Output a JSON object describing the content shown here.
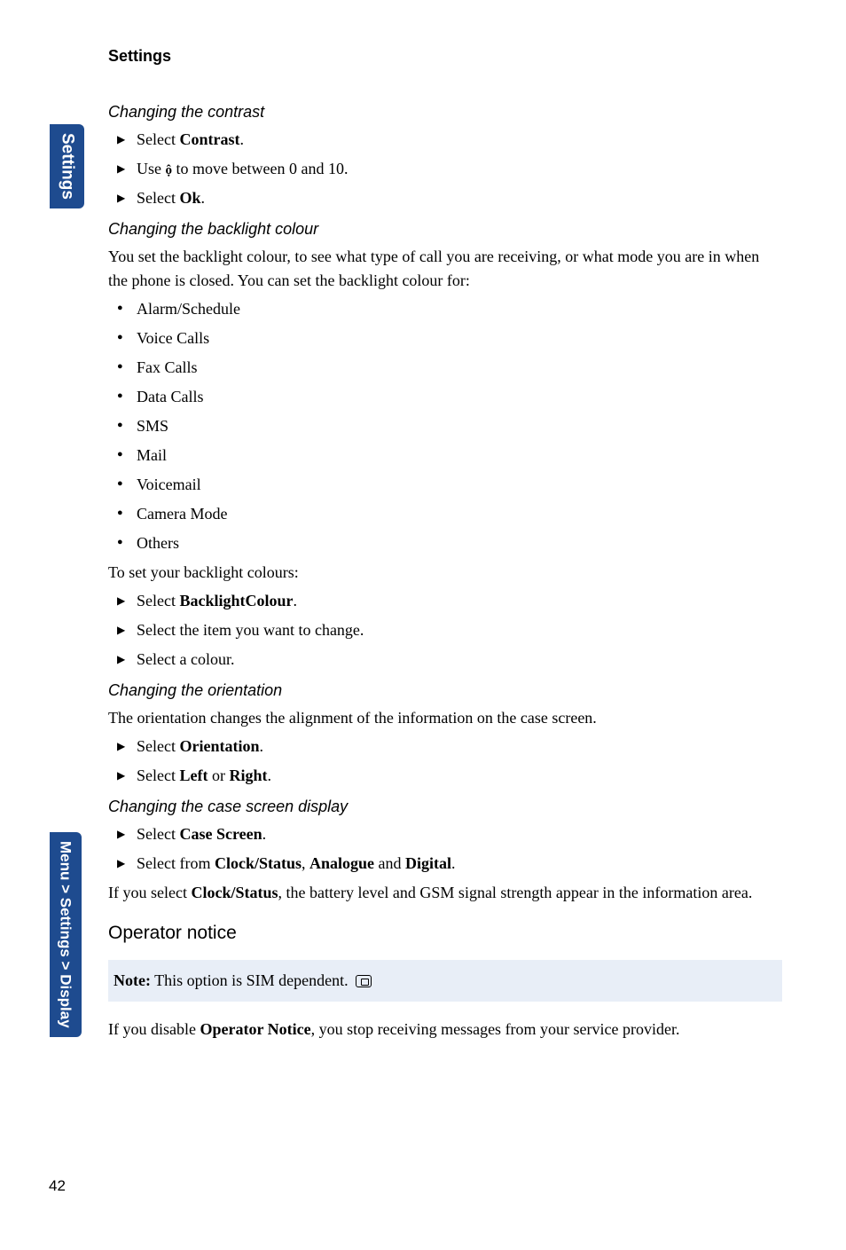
{
  "sidebar": {
    "tab_top": "Settings",
    "tab_bottom": "Menu > Settings > Display"
  },
  "page": {
    "title": "Settings",
    "number": "42"
  },
  "sections": {
    "contrast": {
      "heading": "Changing the contrast",
      "step1_a": "Select ",
      "step1_b": "Contrast",
      "step1_c": ".",
      "step2_a": "Use ",
      "step2_b": " to move between 0 and 10.",
      "step3_a": "Select ",
      "step3_b": "Ok",
      "step3_c": "."
    },
    "backlight": {
      "heading": "Changing the backlight colour",
      "intro": "You set the backlight colour, to see what type of call you are receiving, or what mode you are in when the phone is closed. You can set the backlight colour for:",
      "items": {
        "b1": "Alarm/Schedule",
        "b2": "Voice Calls",
        "b3": "Fax Calls",
        "b4": "Data Calls",
        "b5": "SMS",
        "b6": "Mail",
        "b7": "Voicemail",
        "b8": "Camera Mode",
        "b9": "Others"
      },
      "toset": "To set your backlight colours:",
      "step1_a": "Select ",
      "step1_b": "BacklightColour",
      "step1_c": ".",
      "step2": "Select the item you want to change.",
      "step3": "Select a colour."
    },
    "orientation": {
      "heading": "Changing the orientation",
      "intro": "The orientation changes the alignment of the information on the case screen.",
      "step1_a": "Select ",
      "step1_b": "Orientation",
      "step1_c": ".",
      "step2_a": "Select ",
      "step2_b": "Left",
      "step2_c": " or ",
      "step2_d": "Right",
      "step2_e": "."
    },
    "casescreen": {
      "heading": "Changing the case screen display",
      "step1_a": "Select ",
      "step1_b": "Case Screen",
      "step1_c": ".",
      "step2_a": "Select from ",
      "step2_b": "Clock/Status",
      "step2_c": ", ",
      "step2_d": "Analogue",
      "step2_e": " and ",
      "step2_f": "Digital",
      "step2_g": ".",
      "after_a": "If you select ",
      "after_b": "Clock/Status",
      "after_c": ", the battery level and GSM signal strength appear in the information area."
    },
    "operator": {
      "heading": "Operator notice",
      "note_a": "Note:",
      "note_b": " This option is SIM dependent. ",
      "body_a": "If you disable ",
      "body_b": "Operator Notice",
      "body_c": ", you stop receiving messages from your service provider."
    }
  }
}
